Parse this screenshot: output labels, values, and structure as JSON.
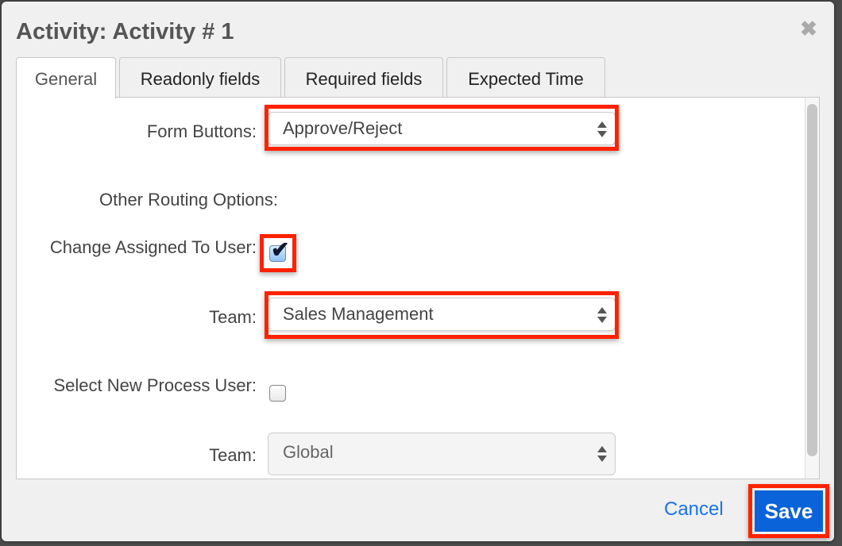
{
  "dialog": {
    "title": "Activity: Activity # 1",
    "close_icon": "close-icon"
  },
  "tabs": [
    {
      "label": "General",
      "active": true
    },
    {
      "label": "Readonly fields",
      "active": false
    },
    {
      "label": "Required fields",
      "active": false
    },
    {
      "label": "Expected Time",
      "active": false
    }
  ],
  "form": {
    "form_buttons": {
      "label": "Form Buttons:",
      "value": "Approve/Reject"
    },
    "other_routing_options": {
      "label": "Other Routing Options:"
    },
    "change_assigned_to_user": {
      "label": "Change Assigned To User:",
      "checked": true
    },
    "team_1": {
      "label": "Team:",
      "value": "Sales Management"
    },
    "select_new_process_user": {
      "label": "Select New Process User:",
      "checked": false
    },
    "team_2": {
      "label": "Team:",
      "value": "Global",
      "disabled": true
    }
  },
  "footer": {
    "cancel_label": "Cancel",
    "save_label": "Save"
  },
  "colors": {
    "highlight": "#ff2200",
    "save_button": "#0a63d8",
    "cancel_link": "#1a73e8"
  }
}
